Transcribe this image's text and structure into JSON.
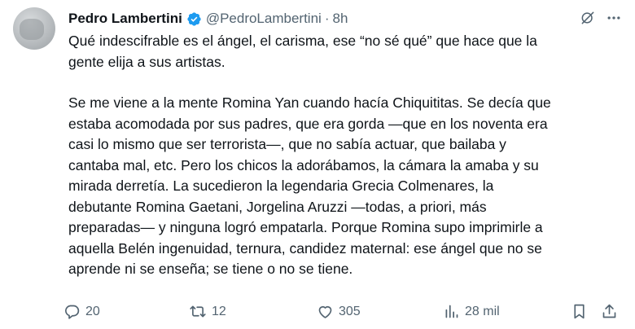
{
  "author": {
    "name": "Pedro Lambertini",
    "handle": "@PedroLambertini",
    "separator": "·",
    "time": "8h"
  },
  "tweet": {
    "paragraph1": "Qué indescifrable es el ángel, el carisma, ese “no sé qué” que hace que la\ngente elija a sus artistas.",
    "paragraph2": "Se me viene a la mente Romina Yan cuando hacía Chiquititas. Se decía que\nestaba acomodada por sus padres, que era gorda —que en los noventa era\ncasi lo mismo que ser terrorista—, que no sabía actuar, que bailaba y\ncantaba mal, etc. Pero los chicos la adorábamos, la cámara la amaba y su\nmirada derretía. La sucedieron la legendaria Grecia Colmenares, la\ndebutante Romina Gaetani, Jorgelina Aruzzi —todas, a priori, más\npreparadas— y ninguna logró empatarla. Porque Romina supo imprimirle a\naquella Belén ingenuidad, ternura, candidez maternal: ese ángel que no se\naprende ni se enseña; se tiene o no se tiene."
  },
  "stats": {
    "replies": "20",
    "retweets": "12",
    "likes": "305",
    "views": "28 mil"
  },
  "icons": {
    "verified": "verified-badge-icon",
    "grok": "grok-icon",
    "more": "more-icon",
    "reply": "reply-icon",
    "retweet": "retweet-icon",
    "like": "heart-icon",
    "views": "views-icon",
    "bookmark": "bookmark-icon",
    "share": "share-icon"
  },
  "colors": {
    "text": "#0f1419",
    "secondary": "#536471",
    "verified": "#1d9bf0"
  }
}
